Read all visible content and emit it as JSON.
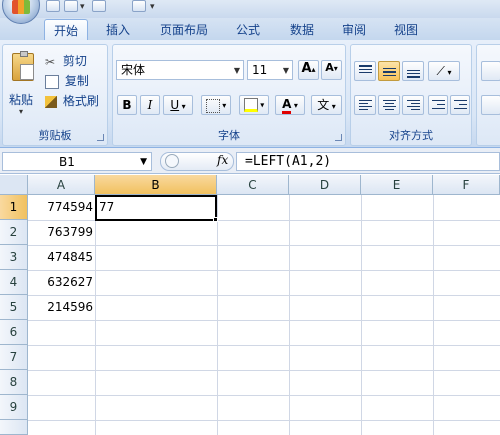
{
  "tabs": [
    "开始",
    "插入",
    "页面布局",
    "公式",
    "数据",
    "审阅",
    "视图"
  ],
  "clipboard": {
    "paste_label": "粘贴",
    "cut_label": "剪切",
    "copy_label": "复制",
    "format_painter_label": "格式刷",
    "group_label": "剪贴板"
  },
  "font": {
    "name": "宋体",
    "size": "11",
    "grow_label": "A",
    "shrink_label": "A",
    "bold": "B",
    "italic": "I",
    "underline": "U",
    "color_label": "A",
    "phonetic_label": "文",
    "group_label": "字体"
  },
  "alignment": {
    "group_label": "对齐方式"
  },
  "formula_bar": {
    "name_box": "B1",
    "fx_label": "fx",
    "formula": "=LEFT(A1,2)"
  },
  "grid": {
    "columns": [
      "A",
      "B",
      "C",
      "D",
      "E",
      "F"
    ],
    "rows": [
      "1",
      "2",
      "3",
      "4",
      "5",
      "6",
      "7",
      "8",
      "9"
    ],
    "col_a_values": [
      "774594",
      "763799",
      "474845",
      "632627",
      "214596"
    ],
    "b1_value": "77",
    "selected_cell": "B1"
  },
  "colors": {
    "ribbon_bg": "#dbe7f6",
    "selected_header": "#f1c15f",
    "gridline": "#d0d7e5"
  }
}
